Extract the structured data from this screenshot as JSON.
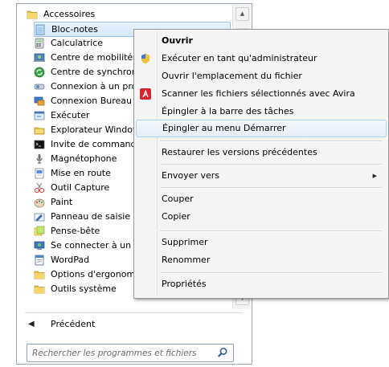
{
  "programs": {
    "folder_header": {
      "label": "Accessoires",
      "icon": "folder-icon"
    },
    "items": [
      {
        "label": "Bloc-notes",
        "icon": "notepad-icon"
      },
      {
        "label": "Calculatrice",
        "icon": "calculator-icon"
      },
      {
        "label": "Centre de mobilité Windows",
        "icon": "mobility-center-icon"
      },
      {
        "label": "Centre de synchronisation",
        "icon": "sync-center-icon"
      },
      {
        "label": "Connexion à un projecteur",
        "icon": "projector-icon"
      },
      {
        "label": "Connexion Bureau à distance",
        "icon": "remote-desktop-icon"
      },
      {
        "label": "Exécuter",
        "icon": "run-icon"
      },
      {
        "label": "Explorateur Windows",
        "icon": "explorer-icon"
      },
      {
        "label": "Invite de commandes",
        "icon": "cmd-icon"
      },
      {
        "label": "Magnétophone",
        "icon": "microphone-icon"
      },
      {
        "label": "Mise en route",
        "icon": "getting-started-icon"
      },
      {
        "label": "Outil Capture",
        "icon": "snipping-tool-icon"
      },
      {
        "label": "Paint",
        "icon": "paint-icon"
      },
      {
        "label": "Panneau de saisie mathématique",
        "icon": "math-input-icon"
      },
      {
        "label": "Pense-bête",
        "icon": "sticky-notes-icon"
      },
      {
        "label": "Se connecter à un projecteur réseau",
        "icon": "network-projector-icon"
      },
      {
        "label": "WordPad",
        "icon": "wordpad-icon"
      },
      {
        "label": "Options d'ergonomie",
        "icon": "folder-icon"
      },
      {
        "label": "Outils système",
        "icon": "folder-icon"
      }
    ],
    "highlighted_item": "Bloc-notes",
    "back_label": "Précédent",
    "search_placeholder": "Rechercher les programmes et fichiers"
  },
  "context_menu": {
    "items": [
      {
        "label": "Ouvrir",
        "bold": true
      },
      {
        "label": "Exécuter en tant qu'administrateur",
        "icon": "uac-shield-icon"
      },
      {
        "label": "Ouvrir l'emplacement du fichier"
      },
      {
        "label": "Scanner les fichiers sélectionnés avec Avira",
        "icon": "avira-icon"
      },
      {
        "label": "Épingler à la barre des tâches"
      },
      {
        "label": "Épingler au menu Démarrer",
        "highlighted": true
      },
      {
        "label": "Restaurer les versions précédentes"
      },
      {
        "label": "Envoyer vers",
        "submenu": true
      },
      {
        "label": "Couper"
      },
      {
        "label": "Copier"
      },
      {
        "label": "Supprimer"
      },
      {
        "label": "Renommer"
      },
      {
        "label": "Propriétés"
      }
    ]
  },
  "colors": {
    "highlight_border": "#9cc4ee",
    "menu_background": "#f5f5f5",
    "avira_red": "#d9232d",
    "folder_yellow": "#e9c14a"
  }
}
